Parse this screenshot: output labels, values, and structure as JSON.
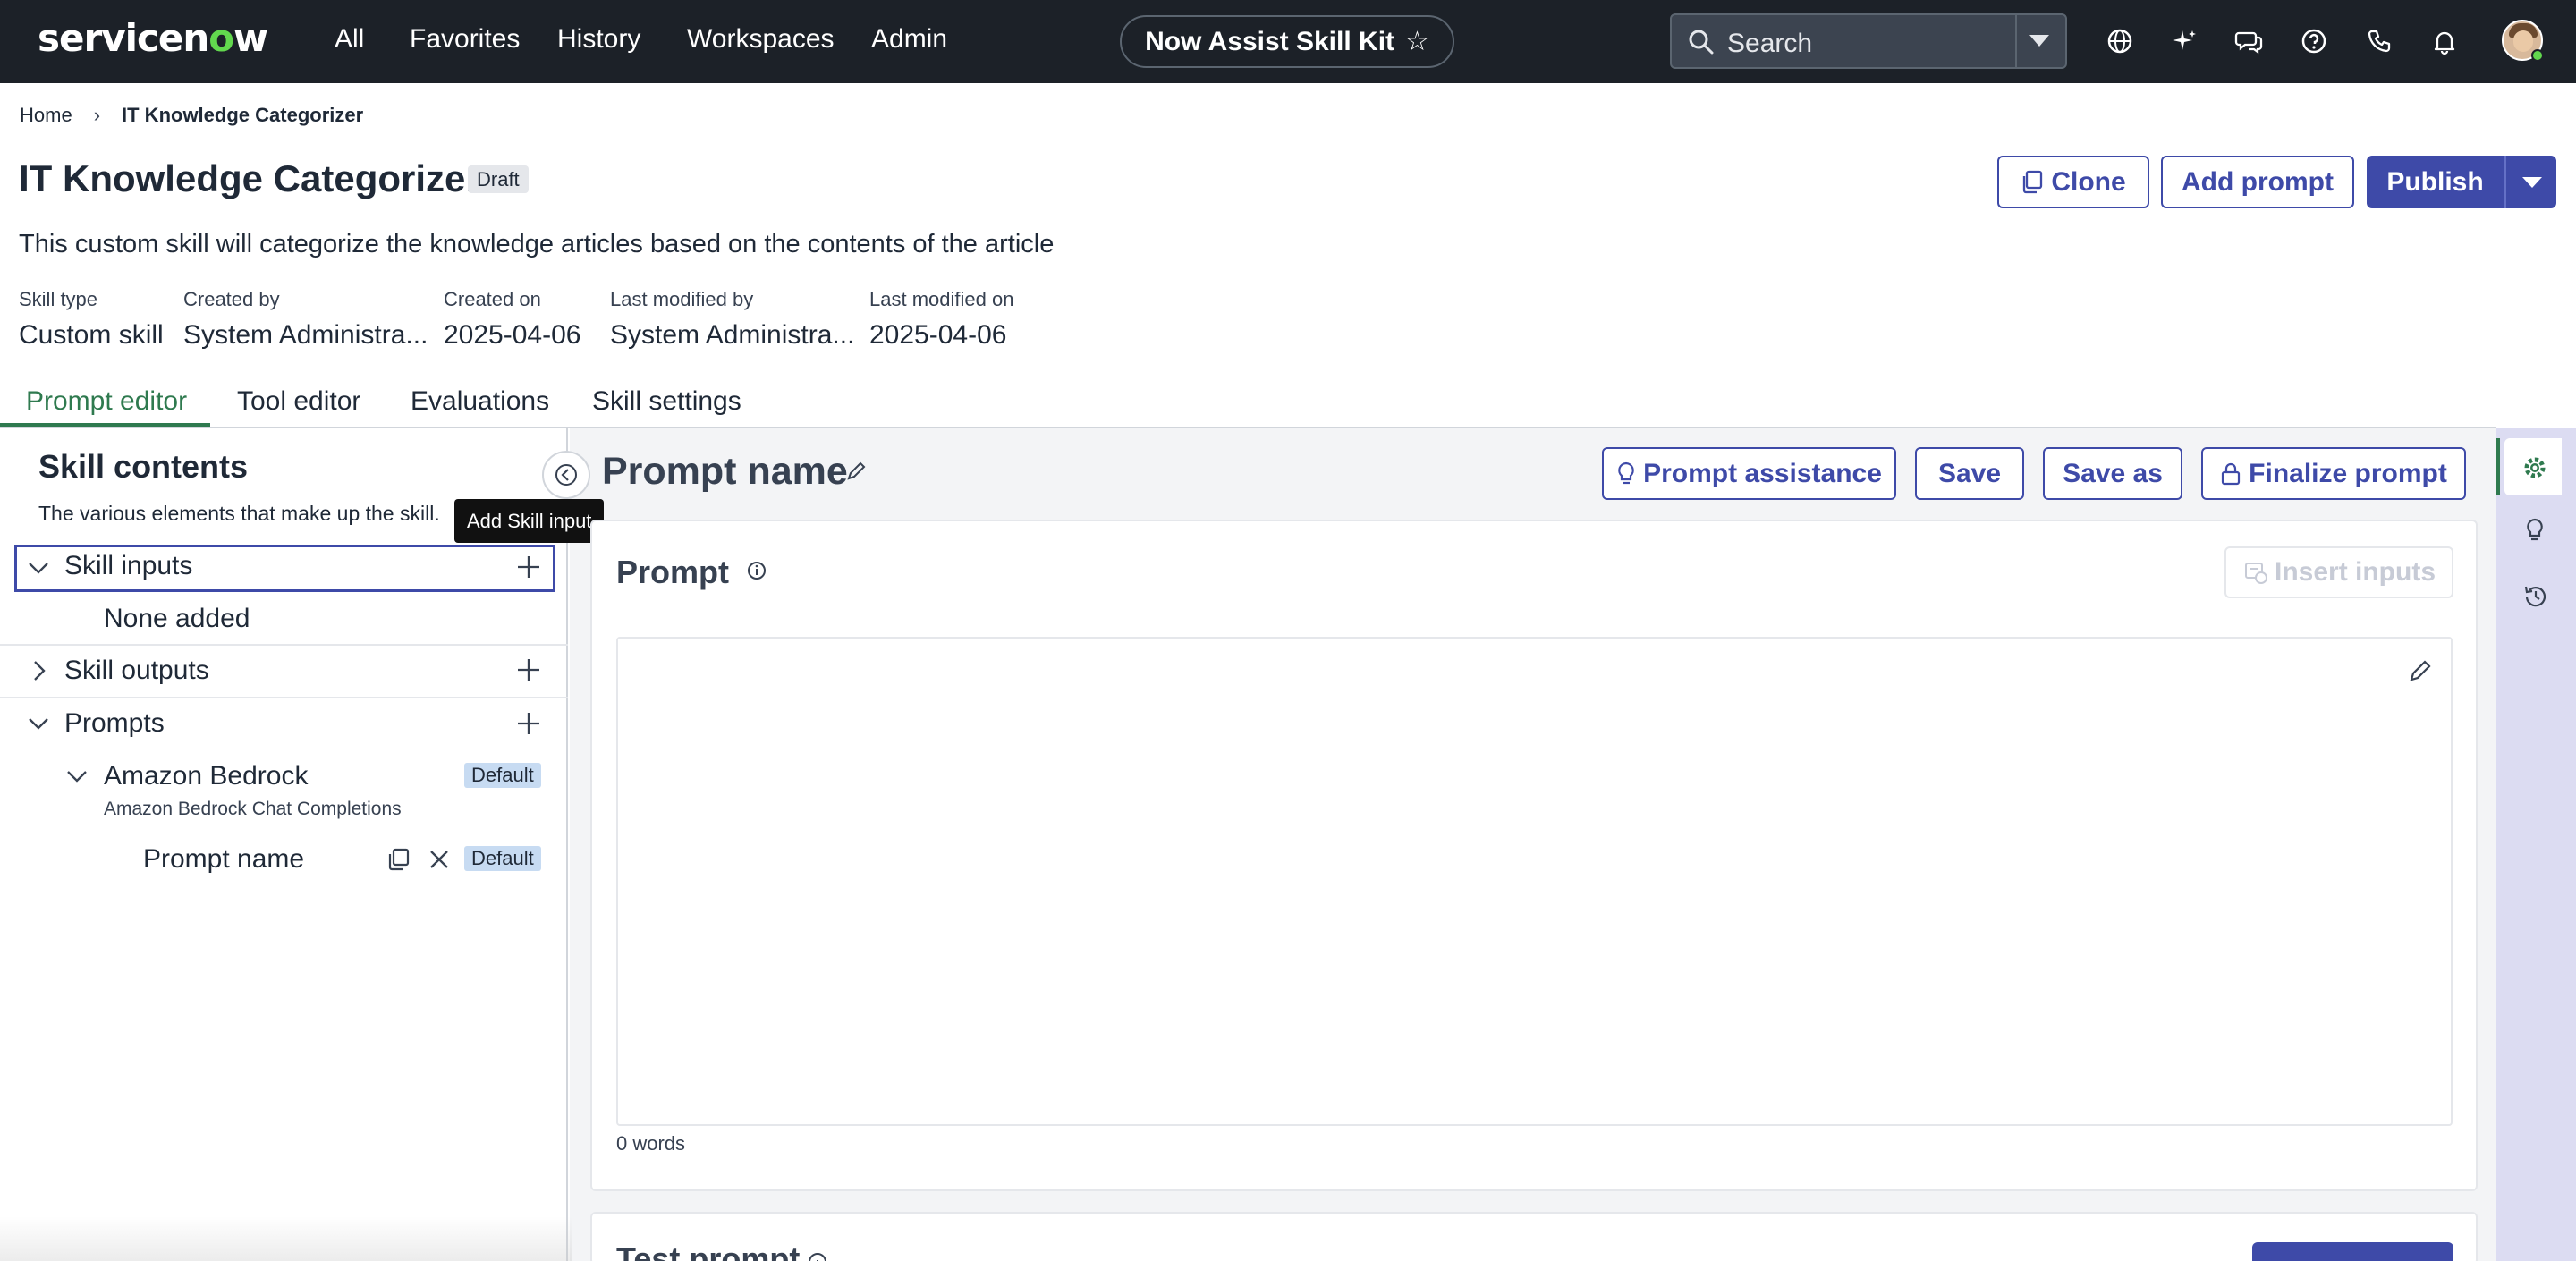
{
  "topbar": {
    "logo_text": "servicenow",
    "nav": [
      "All",
      "Favorites",
      "History",
      "Workspaces",
      "Admin"
    ],
    "center_pill": "Now Assist Skill Kit",
    "search_placeholder": "Search",
    "icons": [
      "globe-icon",
      "sparkle-icon",
      "chat-icon",
      "help-icon",
      "phone-icon",
      "bell-icon"
    ],
    "bg_color": "#1c2128",
    "logo_accent": "#62d84e"
  },
  "breadcrumb": {
    "home": "Home",
    "current": "IT Knowledge Categorizer"
  },
  "header": {
    "title": "IT Knowledge Categorizer",
    "badge": "Draft",
    "description": "This custom skill will categorize the knowledge articles based on the contents of the article",
    "buttons": {
      "clone": "Clone",
      "add_prompt": "Add prompt",
      "publish": "Publish"
    },
    "meta": [
      {
        "label": "Skill type",
        "value": "Custom skill"
      },
      {
        "label": "Created by",
        "value": "System Administra..."
      },
      {
        "label": "Created on",
        "value": "2025-04-06"
      },
      {
        "label": "Last modified by",
        "value": "System Administra..."
      },
      {
        "label": "Last modified on",
        "value": "2025-04-06"
      }
    ]
  },
  "tabs": [
    "Prompt editor",
    "Tool editor",
    "Evaluations",
    "Skill settings"
  ],
  "skill_contents": {
    "title": "Skill contents",
    "subtitle": "The various elements that make up the skill.",
    "tooltip": "Add Skill input",
    "skill_inputs": {
      "label": "Skill inputs",
      "empty": "None added"
    },
    "skill_outputs": {
      "label": "Skill outputs"
    },
    "prompts": {
      "label": "Prompts",
      "provider": {
        "name": "Amazon Bedrock",
        "badge": "Default",
        "subtitle": "Amazon Bedrock Chat Completions",
        "prompt": {
          "name": "Prompt name",
          "badge": "Default"
        }
      }
    }
  },
  "prompt_editor": {
    "title": "Prompt name",
    "buttons": {
      "assistance": "Prompt assistance",
      "save": "Save",
      "save_as": "Save as",
      "finalize": "Finalize prompt"
    },
    "card": {
      "title": "Prompt",
      "insert_inputs": "Insert inputs",
      "word_count": "0 words"
    },
    "test_card": {
      "title": "Test prompt"
    }
  },
  "colors": {
    "primary": "#3e4aa8",
    "active_tab": "#2f7a4f",
    "rail_bg": "#dcdcf2",
    "default_badge": "#c7dbf2"
  }
}
